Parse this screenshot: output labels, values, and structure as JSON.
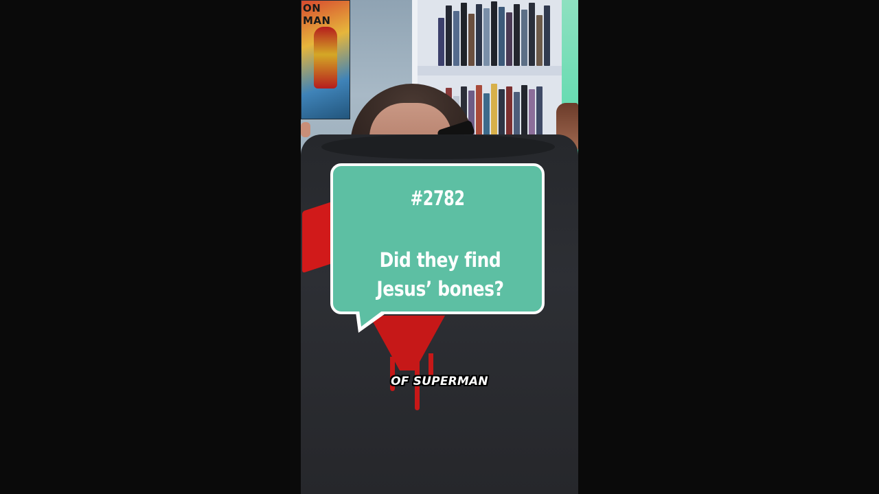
{
  "video": {
    "poster_text": "ON MAN",
    "bubble": {
      "number": "#2782",
      "question": "Did they find Jesus’ bones?",
      "color": "#5dbfa3"
    },
    "caption": "OF SUPERMAN"
  }
}
